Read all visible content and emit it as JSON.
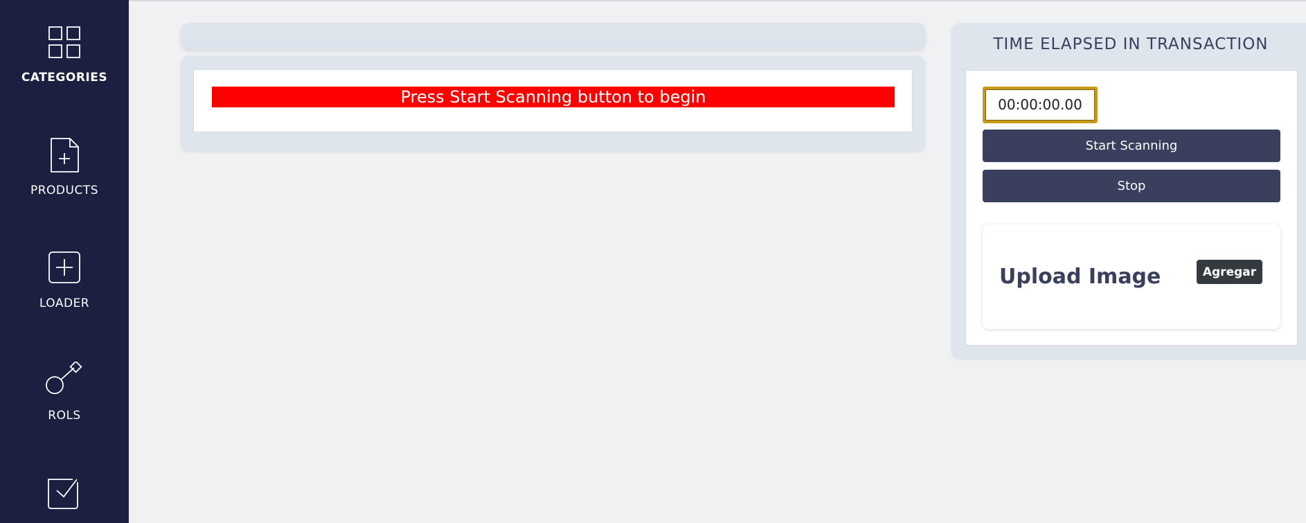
{
  "sidebar": {
    "items": [
      {
        "label": "CATEGORIES",
        "icon": "grid-icon",
        "active": true
      },
      {
        "label": "PRODUCTS",
        "icon": "file-plus-icon"
      },
      {
        "label": "LOADER",
        "icon": "square-plus-icon"
      },
      {
        "label": "ROLS",
        "icon": "key-icon"
      },
      {
        "label": "",
        "icon": "checkbox-icon"
      }
    ]
  },
  "main": {
    "alert_message": "Press Start Scanning button to begin"
  },
  "panel": {
    "title": "TIME ELAPSED IN TRANSACTION",
    "timer_value": "00:00:00.00",
    "start_label": "Start Scanning",
    "stop_label": "Stop",
    "upload_label": "Upload Image",
    "add_label": "Agregar"
  },
  "colors": {
    "sidebar_bg": "#1b2041",
    "alert_bg": "#ff0000",
    "button_bg": "#3b3f5e",
    "timer_border": "#c79a1a"
  }
}
